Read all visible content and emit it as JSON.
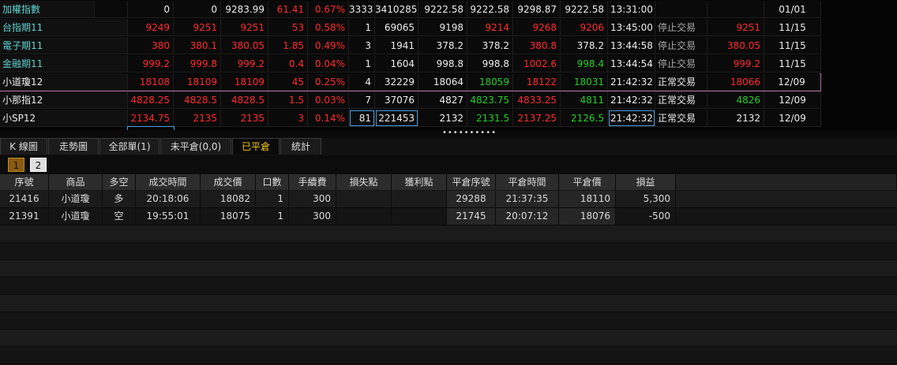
{
  "quotes": [
    {
      "name": "加權指數",
      "name_color": "cyan",
      "c1": "0",
      "c2": "0",
      "c3": "9283.99",
      "c4": "61.41",
      "c5": "0.67%",
      "c6": "3333",
      "c7": "3410285",
      "c8": "9222.58",
      "c9": "9222.58",
      "c10": "9298.87",
      "c11": "9222.58",
      "c12": "13:31:00",
      "c13": "",
      "c14": "",
      "c15": "01/01"
    },
    {
      "name": "台指期11",
      "name_color": "cyan",
      "c1": "9249",
      "c2": "9251",
      "c3": "9251",
      "c4": "53",
      "c5": "0.58%",
      "c6": "1",
      "c7": "69065",
      "c8": "9198",
      "c9": "9214",
      "c10": "9268",
      "c11": "9206",
      "c12": "13:45:00",
      "c13": "停止交易",
      "c14": "9251",
      "c15": "11/15"
    },
    {
      "name": "電子期11",
      "name_color": "cyan",
      "c1": "380",
      "c2": "380.1",
      "c3": "380.05",
      "c4": "1.85",
      "c5": "0.49%",
      "c6": "3",
      "c7": "1941",
      "c8": "378.2",
      "c9": "378.2",
      "c10": "380.8",
      "c11": "378.2",
      "c12": "13:44:58",
      "c13": "停止交易",
      "c14": "380.05",
      "c15": "11/15"
    },
    {
      "name": "金融期11",
      "name_color": "cyan",
      "c1": "999.2",
      "c2": "999.8",
      "c3": "999.2",
      "c4": "0.4",
      "c5": "0.04%",
      "c6": "1",
      "c7": "1604",
      "c8": "998.8",
      "c9": "998.8",
      "c10": "1002.6",
      "c11": "998.4",
      "c12": "13:44:54",
      "c13": "停止交易",
      "c14": "999.2",
      "c15": "11/15"
    },
    {
      "name": "小道瓊12",
      "name_color": "white",
      "c1": "18108",
      "c2": "18109",
      "c3": "18109",
      "c4": "45",
      "c5": "0.25%",
      "c6": "4",
      "c7": "32229",
      "c8": "18064",
      "c9": "18059",
      "c10": "18122",
      "c11": "18031",
      "c12": "21:42:32",
      "c13": "正常交易",
      "c14": "18066",
      "c15": "12/09"
    },
    {
      "name": "小那指12",
      "name_color": "white",
      "c1": "4828.25",
      "c2": "4828.5",
      "c3": "4828.5",
      "c4": "1.5",
      "c5": "0.03%",
      "c6": "7",
      "c7": "37076",
      "c8": "4827",
      "c9": "4823.75",
      "c10": "4833.25",
      "c11": "4811",
      "c12": "21:42:32",
      "c13": "正常交易",
      "c14": "4826",
      "c15": "12/09"
    },
    {
      "name": "小SP12",
      "name_color": "white",
      "c1": "2134.75",
      "c2": "2135",
      "c3": "2135",
      "c4": "3",
      "c5": "0.14%",
      "c6": "81",
      "c7": "221453",
      "c8": "2132",
      "c9": "2131.5",
      "c10": "2137.25",
      "c11": "2126.5",
      "c12": "21:42:32",
      "c13": "正常交易",
      "c14": "2132",
      "c15": "12/09"
    }
  ],
  "splitter_text": "••••••••••",
  "tabs": [
    "K 線圖",
    "走勢圖",
    "全部單(1)",
    "未平倉(0,0)",
    "已平倉",
    "統計"
  ],
  "active_tab": "已平倉",
  "pages": [
    "1",
    "2"
  ],
  "table": {
    "headers": [
      "序號",
      "商品",
      "多空",
      "成交時間",
      "成交價",
      "口數",
      "手續費",
      "損失點",
      "獲利點",
      "平倉序號",
      "平倉時間",
      "平倉價",
      "損益"
    ],
    "rows": [
      {
        "seq": "21416",
        "product": "小道瓊",
        "side": "多",
        "time": "20:18:06",
        "price": "18082",
        "qty": "1",
        "fee": "300",
        "loss": "",
        "profit": "",
        "close_seq": "29288",
        "close_time": "21:37:35",
        "close_price": "18110",
        "pnl": "5,300"
      },
      {
        "seq": "21391",
        "product": "小道瓊",
        "side": "空",
        "time": "19:55:01",
        "price": "18075",
        "qty": "1",
        "fee": "300",
        "loss": "",
        "profit": "",
        "close_seq": "21745",
        "close_time": "20:07:12",
        "close_price": "18076",
        "pnl": "-500"
      }
    ]
  },
  "colors": {
    "up": "#ff2a2a",
    "down": "#22d022",
    "active_tab": "#f5c518",
    "name_cyan": "#5fd1d1"
  }
}
